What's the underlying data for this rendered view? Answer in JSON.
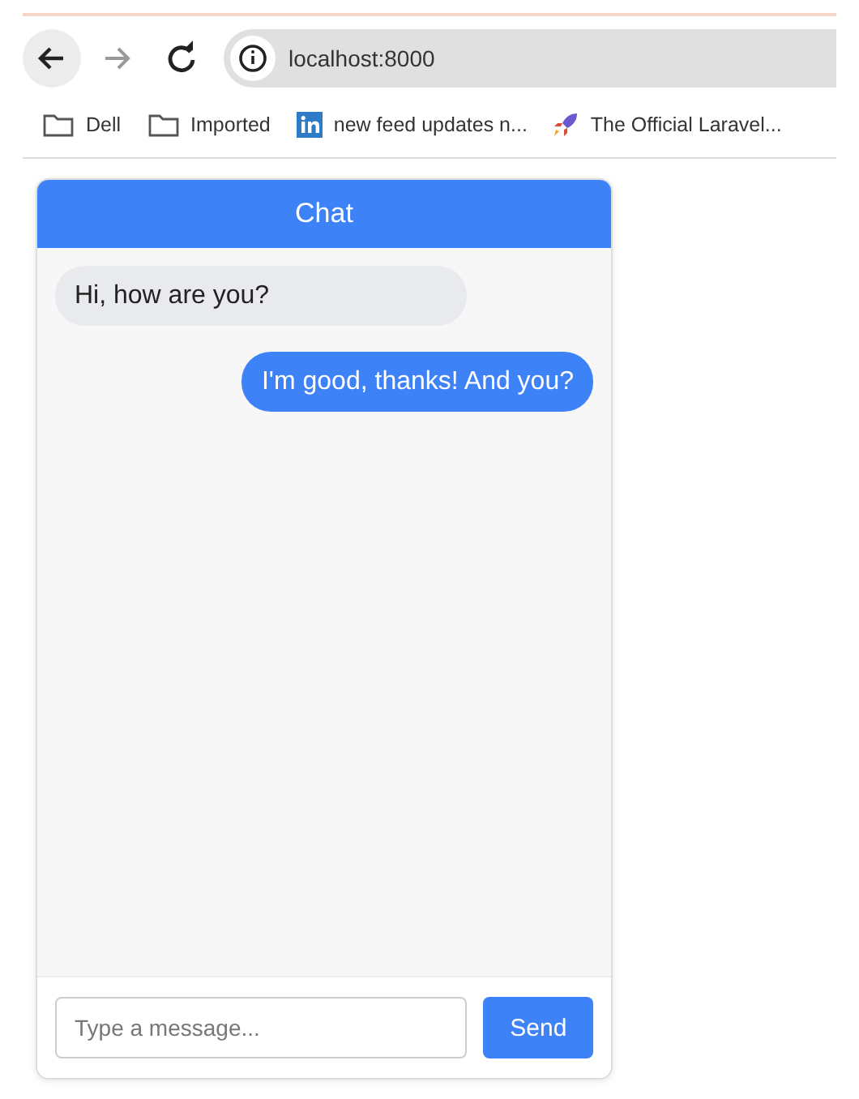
{
  "browser": {
    "url": "localhost:8000",
    "bookmarks": [
      {
        "kind": "folder",
        "label": "Dell"
      },
      {
        "kind": "folder",
        "label": "Imported"
      },
      {
        "kind": "linkedin",
        "label": "new feed updates n..."
      },
      {
        "kind": "rocket",
        "label": "The Official Laravel..."
      }
    ]
  },
  "chat": {
    "title": "Chat",
    "messages": [
      {
        "kind": "received",
        "text": "Hi, how are you?"
      },
      {
        "kind": "sent",
        "text": "I'm good, thanks! And you?"
      }
    ],
    "input": {
      "placeholder": "Type a message..."
    },
    "send_button": "Send"
  }
}
